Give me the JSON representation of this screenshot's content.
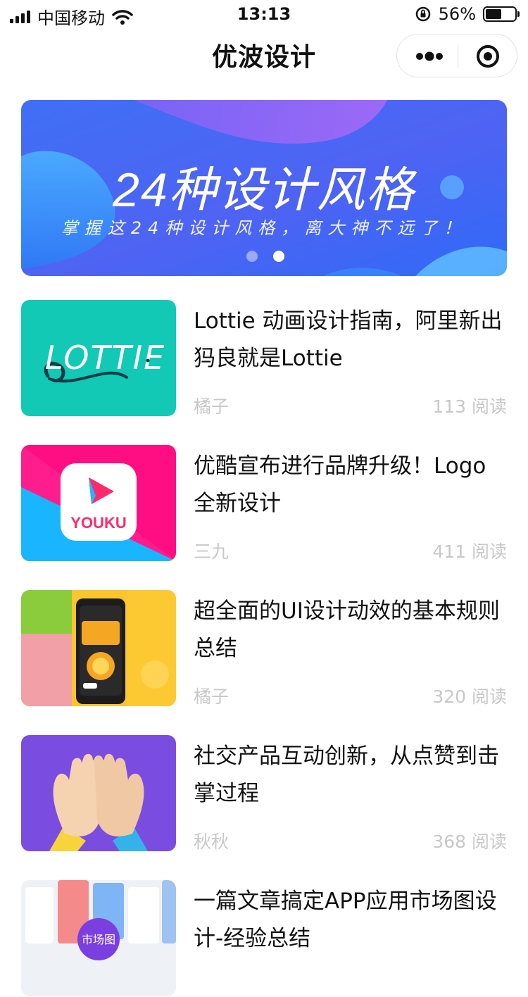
{
  "status_bar": {
    "carrier": "中国移动",
    "time": "13:13",
    "battery": "56%",
    "battery_level": 0.56
  },
  "nav": {
    "title": "优波设计"
  },
  "banner": {
    "title": "24种设计风格",
    "subtitle": "掌握这24种设计风格，离大神不远了！",
    "active_dot": 1,
    "colors": {
      "start": "#3b6cf6",
      "end": "#8a5cf6"
    }
  },
  "thumb_text": {
    "lottie": "LOTTIE",
    "youku": "YOUKU",
    "market": "市场图"
  },
  "articles": [
    {
      "title": "Lottie 动画设计指南，阿里新出犸良就是Lottie",
      "author": "橘子",
      "reads": "113 阅读"
    },
    {
      "title": "优酷宣布进行品牌升级！Logo全新设计",
      "author": "三九",
      "reads": "411 阅读"
    },
    {
      "title": "超全面的UI设计动效的基本规则总结",
      "author": "橘子",
      "reads": "320 阅读"
    },
    {
      "title": "社交产品互动创新，从点赞到击掌过程",
      "author": "秋秋",
      "reads": "368 阅读"
    },
    {
      "title": "一篇文章搞定APP应用市场图设计-经验总结",
      "author": "",
      "reads": ""
    }
  ]
}
